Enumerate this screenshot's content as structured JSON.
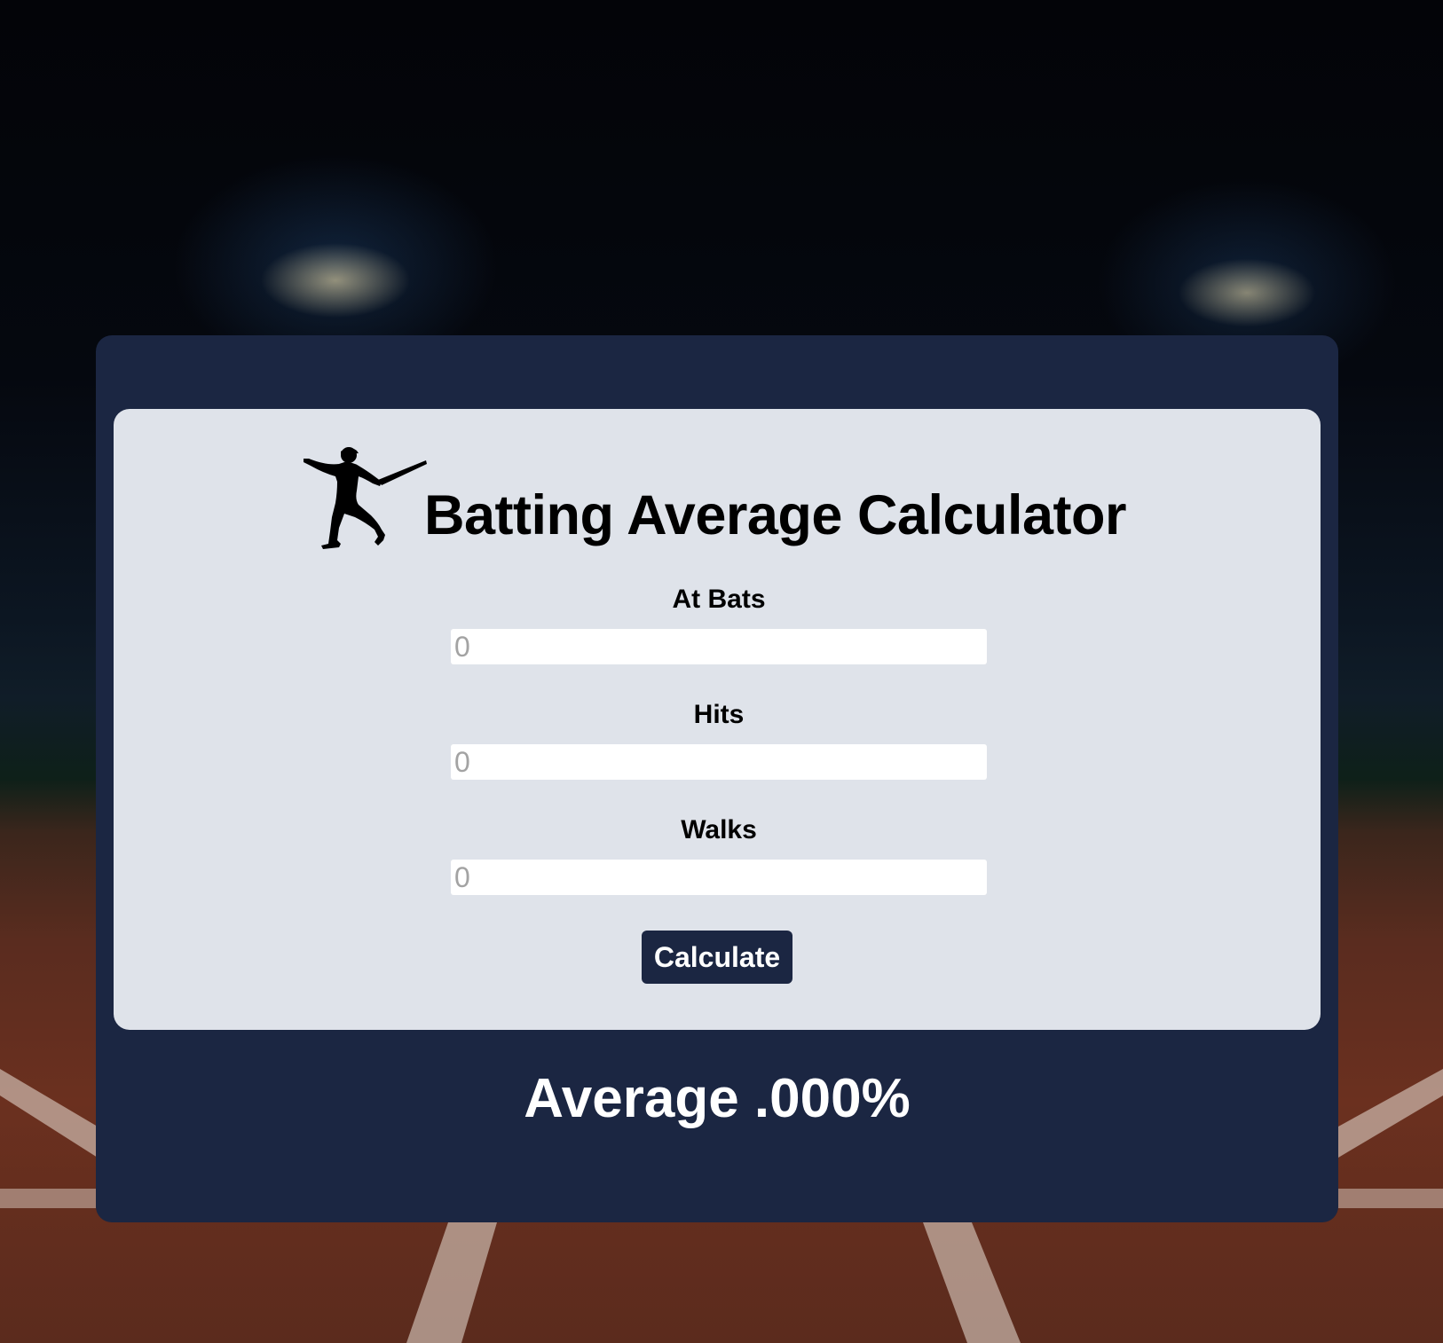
{
  "app": {
    "title": "Batting Average Calculator",
    "logo_icon": "baseball-batter-icon"
  },
  "form": {
    "fields": [
      {
        "label": "At Bats",
        "placeholder": "0",
        "value": ""
      },
      {
        "label": "Hits",
        "placeholder": "0",
        "value": ""
      },
      {
        "label": "Walks",
        "placeholder": "0",
        "value": ""
      }
    ],
    "calculate_label": "Calculate"
  },
  "result": {
    "text": "Average .000%"
  },
  "colors": {
    "panel": "#1b2642",
    "card": "#dfe3ea",
    "button": "#1b2642",
    "button_text": "#ffffff",
    "title_text": "#000000",
    "result_text": "#ffffff"
  }
}
